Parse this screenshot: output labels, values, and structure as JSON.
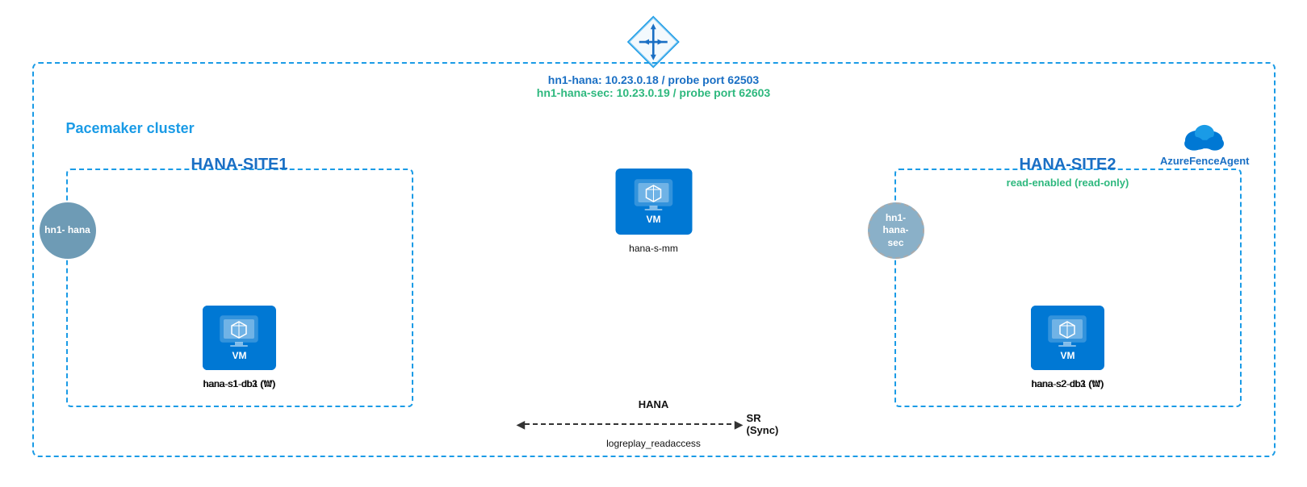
{
  "diagram": {
    "title": "Pacemaker cluster",
    "lb": {
      "primary_label": "hn1-hana:  10.23.0.18 / probe port 62503",
      "secondary_label": "hn1-hana-sec:  10.23.0.19 / probe port 62603"
    },
    "fence_agent": {
      "label": "AzureFenceAgent"
    },
    "site1": {
      "title": "HANA-SITE1",
      "node_label": "hn1-\nhana",
      "vms": [
        {
          "name": "hana-s1-db1 (M)"
        },
        {
          "name": "hana-s1-db2 (W)"
        },
        {
          "name": "hana-s1-db3 (W)"
        }
      ]
    },
    "site2": {
      "title": "HANA-SITE2",
      "node_label": "hn1-\nhana-\nsec",
      "read_enabled": "read-enabled (read-only)",
      "vms": [
        {
          "name": "hana-s2-db1 (M)"
        },
        {
          "name": "hana-s2-db2 (W)"
        },
        {
          "name": "hana-s2-db3 (W)"
        }
      ]
    },
    "mm_node": {
      "name": "hana-s-mm"
    },
    "hana_sr": {
      "label": "HANA",
      "sublabel": "SR (Sync)",
      "subsublabel": "logreplay_readaccess"
    }
  }
}
